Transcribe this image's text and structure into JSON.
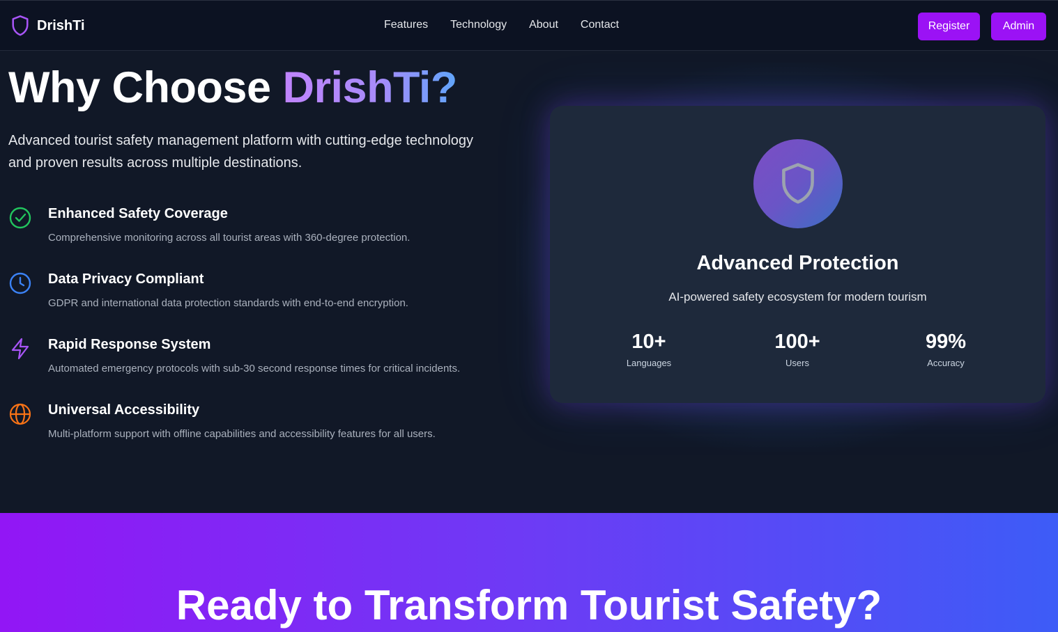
{
  "header": {
    "brand": "DrishTi",
    "nav": [
      "Features",
      "Technology",
      "About",
      "Contact"
    ],
    "register_label": "Register",
    "admin_label": "Admin"
  },
  "hero": {
    "title_prefix": "Why Choose ",
    "title_accent": "DrishTi?",
    "subtitle": "Advanced tourist safety management platform with cutting-edge technology and proven results across multiple destinations."
  },
  "features": [
    {
      "icon": "check-circle-icon",
      "color": "#22c55e",
      "title": "Enhanced Safety Coverage",
      "desc": "Comprehensive monitoring across all tourist areas with 360-degree protection."
    },
    {
      "icon": "clock-icon",
      "color": "#3b82f6",
      "title": "Data Privacy Compliant",
      "desc": "GDPR and international data protection standards with end-to-end encryption."
    },
    {
      "icon": "lightning-icon",
      "color": "#a855f7",
      "title": "Rapid Response System",
      "desc": "Automated emergency protocols with sub-30 second response times for critical incidents."
    },
    {
      "icon": "globe-icon",
      "color": "#f97316",
      "title": "Universal Accessibility",
      "desc": "Multi-platform support with offline capabilities and accessibility features for all users."
    }
  ],
  "card": {
    "title": "Advanced Protection",
    "subtitle": "AI-powered safety ecosystem for modern tourism",
    "stats": [
      {
        "value": "10+",
        "label": "Languages"
      },
      {
        "value": "100+",
        "label": "Users"
      },
      {
        "value": "99%",
        "label": "Accuracy"
      }
    ]
  },
  "cta": {
    "title": "Ready to Transform Tourist Safety?"
  },
  "colors": {
    "accent": "#9b12f5",
    "background": "#111827",
    "card": "#1e293b"
  }
}
